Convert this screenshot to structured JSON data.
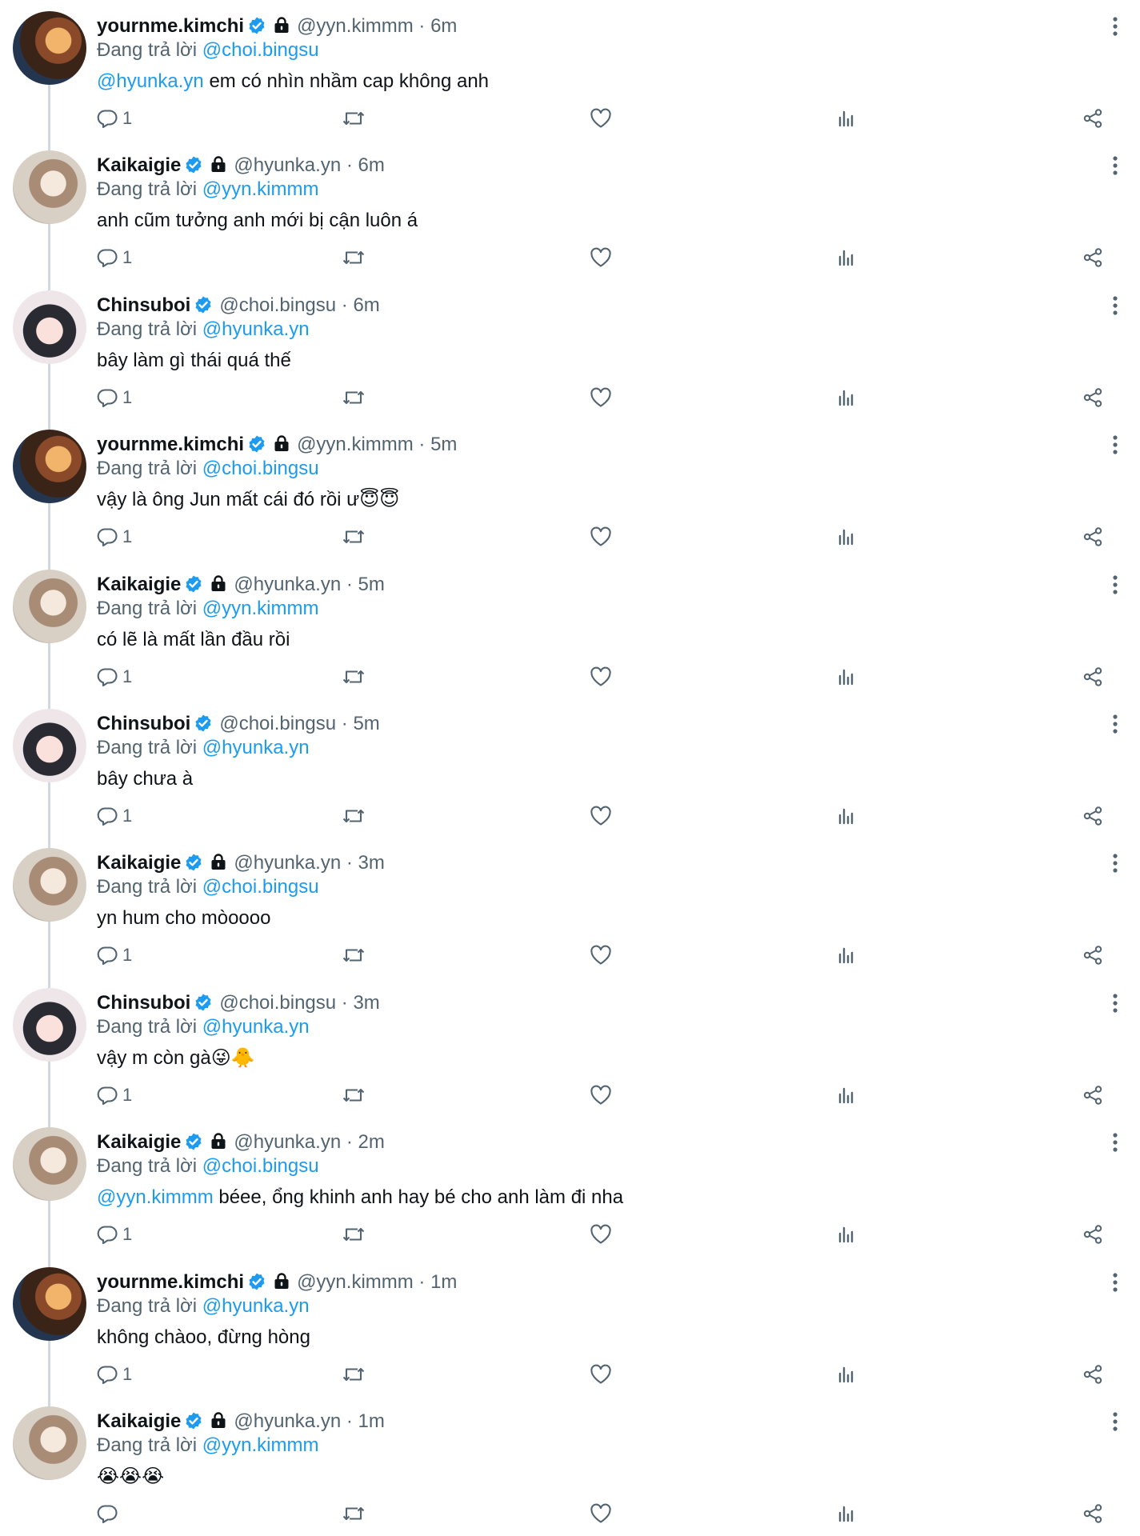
{
  "tweets": [
    {
      "avatar": "yourn",
      "name": "yournme.kimchi",
      "locked": true,
      "handle": "@yyn.kimmm",
      "time": "6m",
      "reply_prefix": "Đang trả lời",
      "reply_to": "@choi.bingsu",
      "mention": "@hyunka.yn",
      "text": " em có nhìn nhầm cap không anh",
      "reply_count": "1"
    },
    {
      "avatar": "kaik",
      "name": "Kaikaigie",
      "locked": true,
      "handle": "@hyunka.yn",
      "time": "6m",
      "reply_prefix": "Đang trả lời",
      "reply_to": "@yyn.kimmm",
      "mention": "",
      "text": "anh cũm tưởng anh mới bị cận luôn á",
      "reply_count": "1"
    },
    {
      "avatar": "chins",
      "name": "Chinsuboi",
      "locked": false,
      "handle": "@choi.bingsu",
      "time": "6m",
      "reply_prefix": "Đang trả lời",
      "reply_to": "@hyunka.yn",
      "mention": "",
      "text": "bây làm gì thái quá thế",
      "reply_count": "1"
    },
    {
      "avatar": "yourn",
      "name": "yournme.kimchi",
      "locked": true,
      "handle": "@yyn.kimmm",
      "time": "5m",
      "reply_prefix": "Đang trả lời",
      "reply_to": "@choi.bingsu",
      "mention": "",
      "text": "vậy là ông Jun mất cái đó rồi ư😇😇",
      "reply_count": "1"
    },
    {
      "avatar": "kaik",
      "name": "Kaikaigie",
      "locked": true,
      "handle": "@hyunka.yn",
      "time": "5m",
      "reply_prefix": "Đang trả lời",
      "reply_to": "@yyn.kimmm",
      "mention": "",
      "text": "có lẽ là mất lần đầu rồi",
      "reply_count": "1"
    },
    {
      "avatar": "chins",
      "name": "Chinsuboi",
      "locked": false,
      "handle": "@choi.bingsu",
      "time": "5m",
      "reply_prefix": "Đang trả lời",
      "reply_to": "@hyunka.yn",
      "mention": "",
      "text": "bây chưa à",
      "reply_count": "1"
    },
    {
      "avatar": "kaik",
      "name": "Kaikaigie",
      "locked": true,
      "handle": "@hyunka.yn",
      "time": "3m",
      "reply_prefix": "Đang trả lời",
      "reply_to": "@choi.bingsu",
      "mention": "",
      "text": "yn hum cho mòoooo",
      "reply_count": "1"
    },
    {
      "avatar": "chins",
      "name": "Chinsuboi",
      "locked": false,
      "handle": "@choi.bingsu",
      "time": "3m",
      "reply_prefix": "Đang trả lời",
      "reply_to": "@hyunka.yn",
      "mention": "",
      "text": "vậy m còn gà😜🐥",
      "reply_count": "1"
    },
    {
      "avatar": "kaik",
      "name": "Kaikaigie",
      "locked": true,
      "handle": "@hyunka.yn",
      "time": "2m",
      "reply_prefix": "Đang trả lời",
      "reply_to": "@choi.bingsu",
      "mention": "@yyn.kimmm",
      "text": " béee, ổng khinh anh hay bé cho anh làm đi nha",
      "reply_count": "1"
    },
    {
      "avatar": "yourn",
      "name": "yournme.kimchi",
      "locked": true,
      "handle": "@yyn.kimmm",
      "time": "1m",
      "reply_prefix": "Đang trả lời",
      "reply_to": "@hyunka.yn",
      "mention": "",
      "text": "không chàoo, đừng hòng",
      "reply_count": "1"
    },
    {
      "avatar": "kaik",
      "name": "Kaikaigie",
      "locked": true,
      "handle": "@hyunka.yn",
      "time": "1m",
      "reply_prefix": "Đang trả lời",
      "reply_to": "@yyn.kimmm",
      "mention": "",
      "text": "😭😭😭",
      "reply_count": ""
    }
  ],
  "separator": " · ",
  "colors": {
    "link": "#1d9bf0",
    "verified": "#1d9bf0",
    "secondary": "#536471",
    "text": "#0f1419",
    "thread_line": "#cfd9de"
  },
  "icons": {
    "verified": "verified-badge-icon",
    "lock": "lock-icon",
    "reply": "reply-icon",
    "retweet": "retweet-icon",
    "like": "heart-icon",
    "views": "views-chart-icon",
    "share": "share-icon",
    "more": "more-options-icon"
  }
}
